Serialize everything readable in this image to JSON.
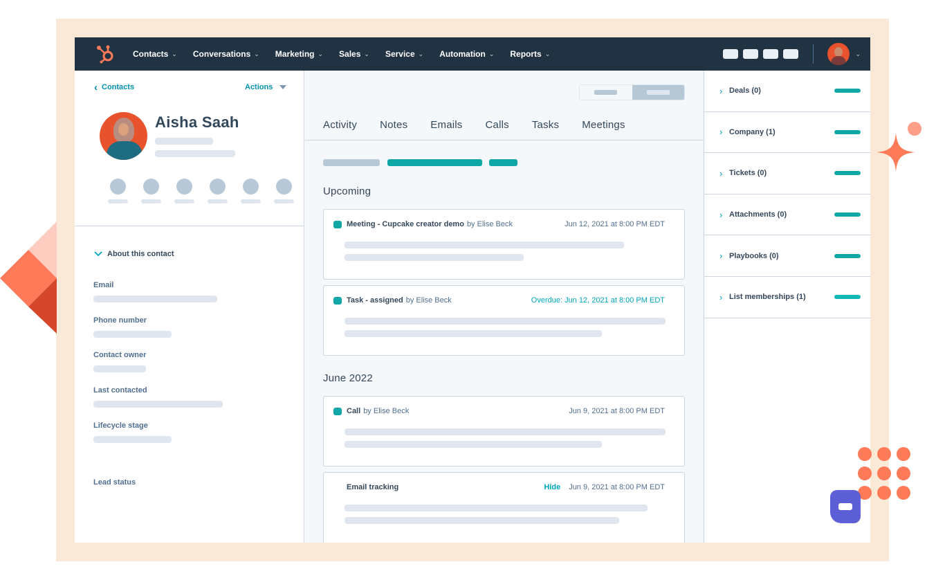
{
  "nav": {
    "logo": "hubspot-sprocket",
    "menu": [
      {
        "label": "Contacts"
      },
      {
        "label": "Conversations"
      },
      {
        "label": "Marketing"
      },
      {
        "label": "Sales"
      },
      {
        "label": "Service"
      },
      {
        "label": "Automation"
      },
      {
        "label": "Reports"
      }
    ],
    "chevron": "⌄",
    "user_chevron": "⌄"
  },
  "contact": {
    "back_label": "Contacts",
    "back_icon": "‹",
    "actions_label": "Actions",
    "name": "Aisha Saah",
    "about_header": "About this contact",
    "about_icon": "⌄",
    "properties": [
      {
        "label": "Email"
      },
      {
        "label": "Phone number"
      },
      {
        "label": "Contact owner"
      },
      {
        "label": "Last contacted"
      },
      {
        "label": "Lifecycle stage"
      },
      {
        "label": "Lead status"
      }
    ]
  },
  "timeline": {
    "tabs": [
      {
        "label": "Activity"
      },
      {
        "label": "Notes"
      },
      {
        "label": "Emails"
      },
      {
        "label": "Calls"
      },
      {
        "label": "Tasks"
      },
      {
        "label": "Meetings"
      }
    ],
    "sections": [
      {
        "title": "Upcoming"
      },
      {
        "title": "June 2022"
      }
    ],
    "cards": [
      {
        "title": "Meeting - Cupcake creator demo",
        "by": "by Elise Beck",
        "date": "Jun 12, 2021 at 8:00 PM EDT"
      },
      {
        "title": "Task - assigned",
        "by": "by Elise Beck",
        "date": "Overdue: Jun 12, 2021 at 8:00 PM EDT"
      },
      {
        "title": "Call",
        "by": "by Elise Beck",
        "date": "Jun 9, 2021 at 8:00 PM EDT"
      },
      {
        "title": "Email tracking",
        "hide": "Hide",
        "date": "Jun 9, 2021 at 8:00 PM EDT"
      }
    ]
  },
  "sidebar": {
    "chevron": "›",
    "items": [
      {
        "label": "Deals (0)"
      },
      {
        "label": "Company (1)"
      },
      {
        "label": "Tickets (0)"
      },
      {
        "label": "Attachments (0)"
      },
      {
        "label": "Playbooks (0)"
      },
      {
        "label": "List memberships (1)"
      }
    ]
  },
  "colors": {
    "nav_bg": "#213343",
    "accent_teal": "#0fa8a6",
    "link": "#0091ae",
    "brand_orange": "#ff7a59",
    "frame_bg": "#fbe9d7",
    "chat_purple": "#5c5fd6"
  }
}
